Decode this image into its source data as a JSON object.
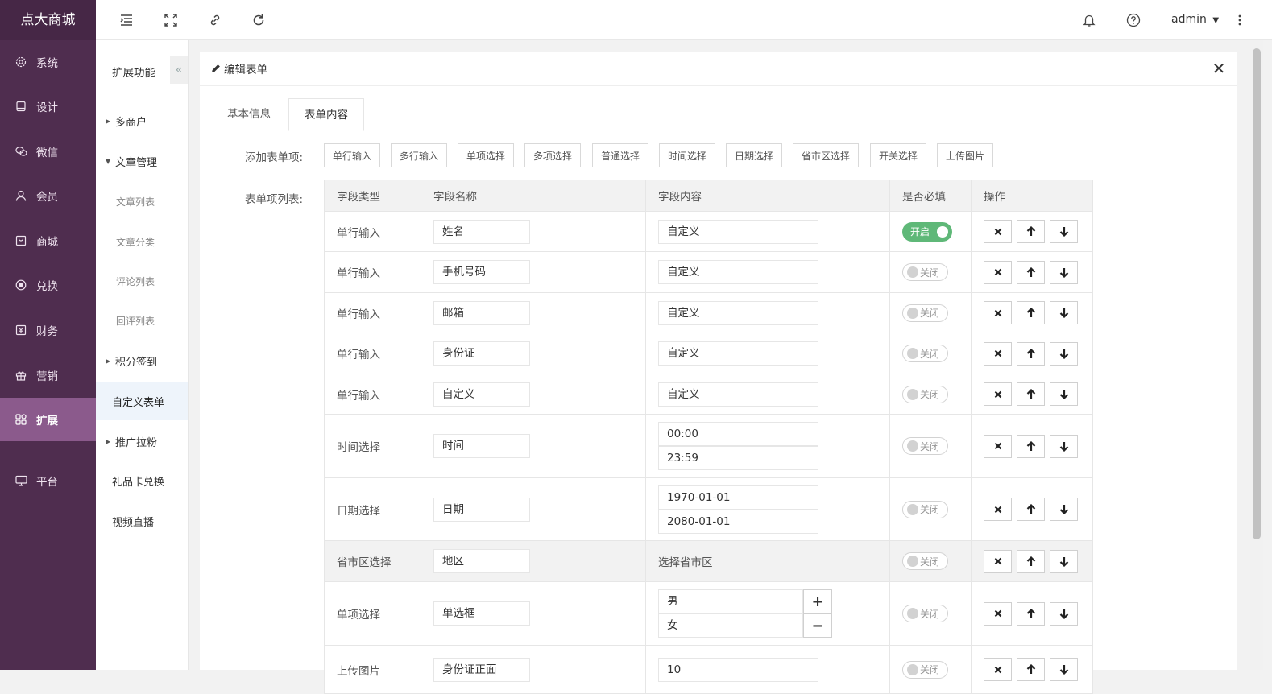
{
  "brand": "点大商城",
  "nav": [
    {
      "label": "系统",
      "icon": "gear-icon"
    },
    {
      "label": "设计",
      "icon": "design-icon"
    },
    {
      "label": "微信",
      "icon": "wechat-icon"
    },
    {
      "label": "会员",
      "icon": "user-icon"
    },
    {
      "label": "商城",
      "icon": "shop-icon"
    },
    {
      "label": "兑换",
      "icon": "exchange-icon"
    },
    {
      "label": "财务",
      "icon": "finance-icon"
    },
    {
      "label": "营销",
      "icon": "gift-icon"
    },
    {
      "label": "扩展",
      "icon": "grid-icon",
      "active": true
    },
    {
      "label": "平台",
      "icon": "monitor-icon"
    }
  ],
  "subnav": {
    "title": "扩展功能",
    "collapse": "«",
    "items": [
      {
        "label": "多商户",
        "type": "group",
        "arrow": "▶"
      },
      {
        "label": "文章管理",
        "type": "group",
        "arrow": "▼"
      },
      {
        "label": "文章列表",
        "type": "child"
      },
      {
        "label": "文章分类",
        "type": "child"
      },
      {
        "label": "评论列表",
        "type": "child"
      },
      {
        "label": "回评列表",
        "type": "child"
      },
      {
        "label": "积分签到",
        "type": "group",
        "arrow": "▶"
      },
      {
        "label": "自定义表单",
        "type": "leaf",
        "active": true
      },
      {
        "label": "推广拉粉",
        "type": "group",
        "arrow": "▶"
      },
      {
        "label": "礼品卡兑换",
        "type": "leaf"
      },
      {
        "label": "视频直播",
        "type": "leaf"
      }
    ]
  },
  "topbar": {
    "user": "admin",
    "icons": [
      "menu-toggle-icon",
      "fullscreen-icon",
      "link-icon",
      "refresh-icon",
      "bell-icon",
      "help-icon",
      "more-icon"
    ]
  },
  "panel": {
    "title": "编辑表单",
    "close": "✕",
    "tabs": [
      "基本信息",
      "表单内容"
    ],
    "active_tab": 1,
    "add_label": "添加表单项:",
    "list_label": "表单项列表:",
    "add_buttons": [
      "单行输入",
      "多行输入",
      "单项选择",
      "多项选择",
      "普通选择",
      "时间选择",
      "日期选择",
      "省市区选择",
      "开关选择",
      "上传图片"
    ],
    "columns": [
      "字段类型",
      "字段名称",
      "字段内容",
      "是否必填",
      "操作"
    ],
    "rows": [
      {
        "type": "单行输入",
        "name": "姓名",
        "content": [
          "自定义"
        ],
        "kind": "input",
        "required": true
      },
      {
        "type": "单行输入",
        "name": "手机号码",
        "content": [
          "自定义"
        ],
        "kind": "input",
        "required": false
      },
      {
        "type": "单行输入",
        "name": "邮箱",
        "content": [
          "自定义"
        ],
        "kind": "input",
        "required": false
      },
      {
        "type": "单行输入",
        "name": "身份证",
        "content": [
          "自定义"
        ],
        "kind": "input",
        "required": false
      },
      {
        "type": "单行输入",
        "name": "自定义",
        "content": [
          "自定义"
        ],
        "kind": "input",
        "required": false
      },
      {
        "type": "时间选择",
        "name": "时间",
        "content": [
          "00:00",
          "23:59"
        ],
        "kind": "input",
        "required": false
      },
      {
        "type": "日期选择",
        "name": "日期",
        "content": [
          "1970-01-01",
          "2080-01-01"
        ],
        "kind": "input",
        "required": false
      },
      {
        "type": "省市区选择",
        "name": "地区",
        "content": [
          "选择省市区"
        ],
        "kind": "text",
        "required": false,
        "hover": true
      },
      {
        "type": "单项选择",
        "name": "单选框",
        "content": [
          "男",
          "女"
        ],
        "kind": "options",
        "required": false
      },
      {
        "type": "上传图片",
        "name": "身份证正面",
        "content": [
          "10"
        ],
        "kind": "input",
        "required": false
      }
    ],
    "switch_on": "开启",
    "switch_off": "关闭",
    "op_icons": [
      "delete-icon",
      "move-up-icon",
      "move-down-icon"
    ]
  }
}
